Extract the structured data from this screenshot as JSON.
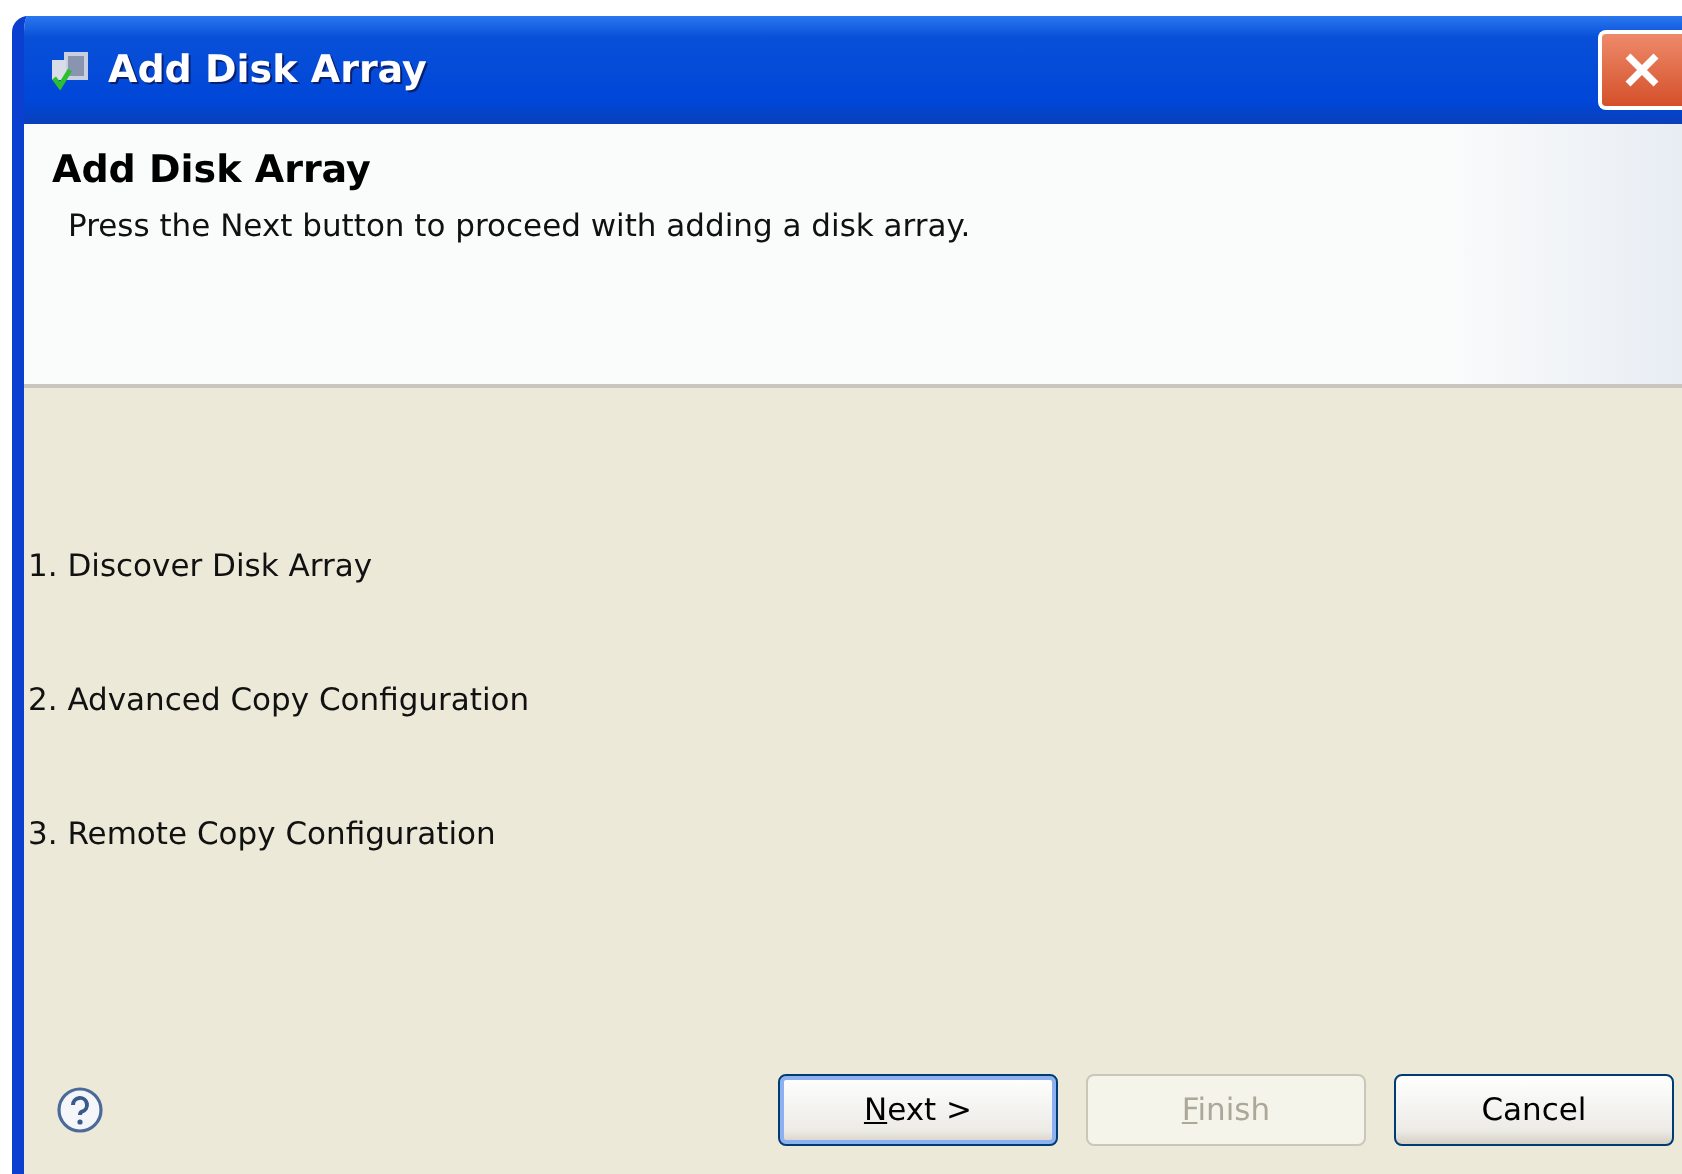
{
  "window": {
    "title": "Add Disk Array"
  },
  "header": {
    "title": "Add Disk Array",
    "description": "Press the Next button to proceed with adding a disk array."
  },
  "steps": [
    "1. Discover Disk Array",
    "2. Advanced Copy Configuration",
    "3. Remote Copy Configuration"
  ],
  "buttons": [
    {
      "label": "Next >",
      "default": true,
      "disabled": false,
      "mnemonic": true
    },
    {
      "label": "Finish",
      "default": false,
      "disabled": true,
      "mnemonic": true
    },
    {
      "label": "Cancel",
      "default": false,
      "disabled": false,
      "mnemonic": false
    }
  ]
}
